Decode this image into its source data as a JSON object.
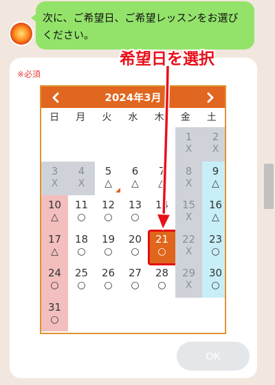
{
  "chat": {
    "message": "次に、ご希望日、ご希望レッスンをお選びください。"
  },
  "form": {
    "required_label": "※必須",
    "annotation": "希望日を選択",
    "ok_label": "OK"
  },
  "calendar": {
    "title": "2024年3月",
    "prev_icon": "chevron-left-icon",
    "next_icon": "chevron-right-icon",
    "weekdays": [
      "日",
      "月",
      "火",
      "水",
      "木",
      "金",
      "土"
    ],
    "days": [
      {
        "day": "",
        "mark": ""
      },
      {
        "day": "",
        "mark": ""
      },
      {
        "day": "",
        "mark": ""
      },
      {
        "day": "",
        "mark": ""
      },
      {
        "day": "",
        "mark": ""
      },
      {
        "day": "1",
        "mark": "X",
        "status": "closed"
      },
      {
        "day": "2",
        "mark": "X",
        "status": "closed"
      },
      {
        "day": "3",
        "mark": "X",
        "status": "closed"
      },
      {
        "day": "4",
        "mark": "X",
        "status": "closed"
      },
      {
        "day": "5",
        "mark": "△",
        "status": "open"
      },
      {
        "day": "6",
        "mark": "△",
        "status": "open"
      },
      {
        "day": "7",
        "mark": "△",
        "status": "open"
      },
      {
        "day": "8",
        "mark": "X",
        "status": "closed"
      },
      {
        "day": "9",
        "mark": "△",
        "status": "open"
      },
      {
        "day": "10",
        "mark": "△",
        "status": "open"
      },
      {
        "day": "11",
        "mark": "○",
        "status": "open"
      },
      {
        "day": "12",
        "mark": "○",
        "status": "open"
      },
      {
        "day": "13",
        "mark": "○",
        "status": "open"
      },
      {
        "day": "14",
        "mark": "○",
        "status": "open"
      },
      {
        "day": "15",
        "mark": "X",
        "status": "closed"
      },
      {
        "day": "16",
        "mark": "△",
        "status": "open"
      },
      {
        "day": "17",
        "mark": "△",
        "status": "open"
      },
      {
        "day": "18",
        "mark": "○",
        "status": "open"
      },
      {
        "day": "19",
        "mark": "○",
        "status": "open"
      },
      {
        "day": "20",
        "mark": "○",
        "status": "open"
      },
      {
        "day": "21",
        "mark": "○",
        "status": "selected"
      },
      {
        "day": "22",
        "mark": "X",
        "status": "closed"
      },
      {
        "day": "23",
        "mark": "○",
        "status": "open"
      },
      {
        "day": "24",
        "mark": "○",
        "status": "open"
      },
      {
        "day": "25",
        "mark": "○",
        "status": "open"
      },
      {
        "day": "26",
        "mark": "○",
        "status": "open"
      },
      {
        "day": "27",
        "mark": "○",
        "status": "open"
      },
      {
        "day": "28",
        "mark": "○",
        "status": "open"
      },
      {
        "day": "29",
        "mark": "X",
        "status": "closed"
      },
      {
        "day": "30",
        "mark": "○",
        "status": "open"
      },
      {
        "day": "31",
        "mark": "○",
        "status": "open"
      }
    ],
    "colors": {
      "header": "#e1661f",
      "sunday": "#f2bebe",
      "saturday": "#c8eff8",
      "closed": "#cfd3d9",
      "selected": "#e0661d"
    }
  }
}
